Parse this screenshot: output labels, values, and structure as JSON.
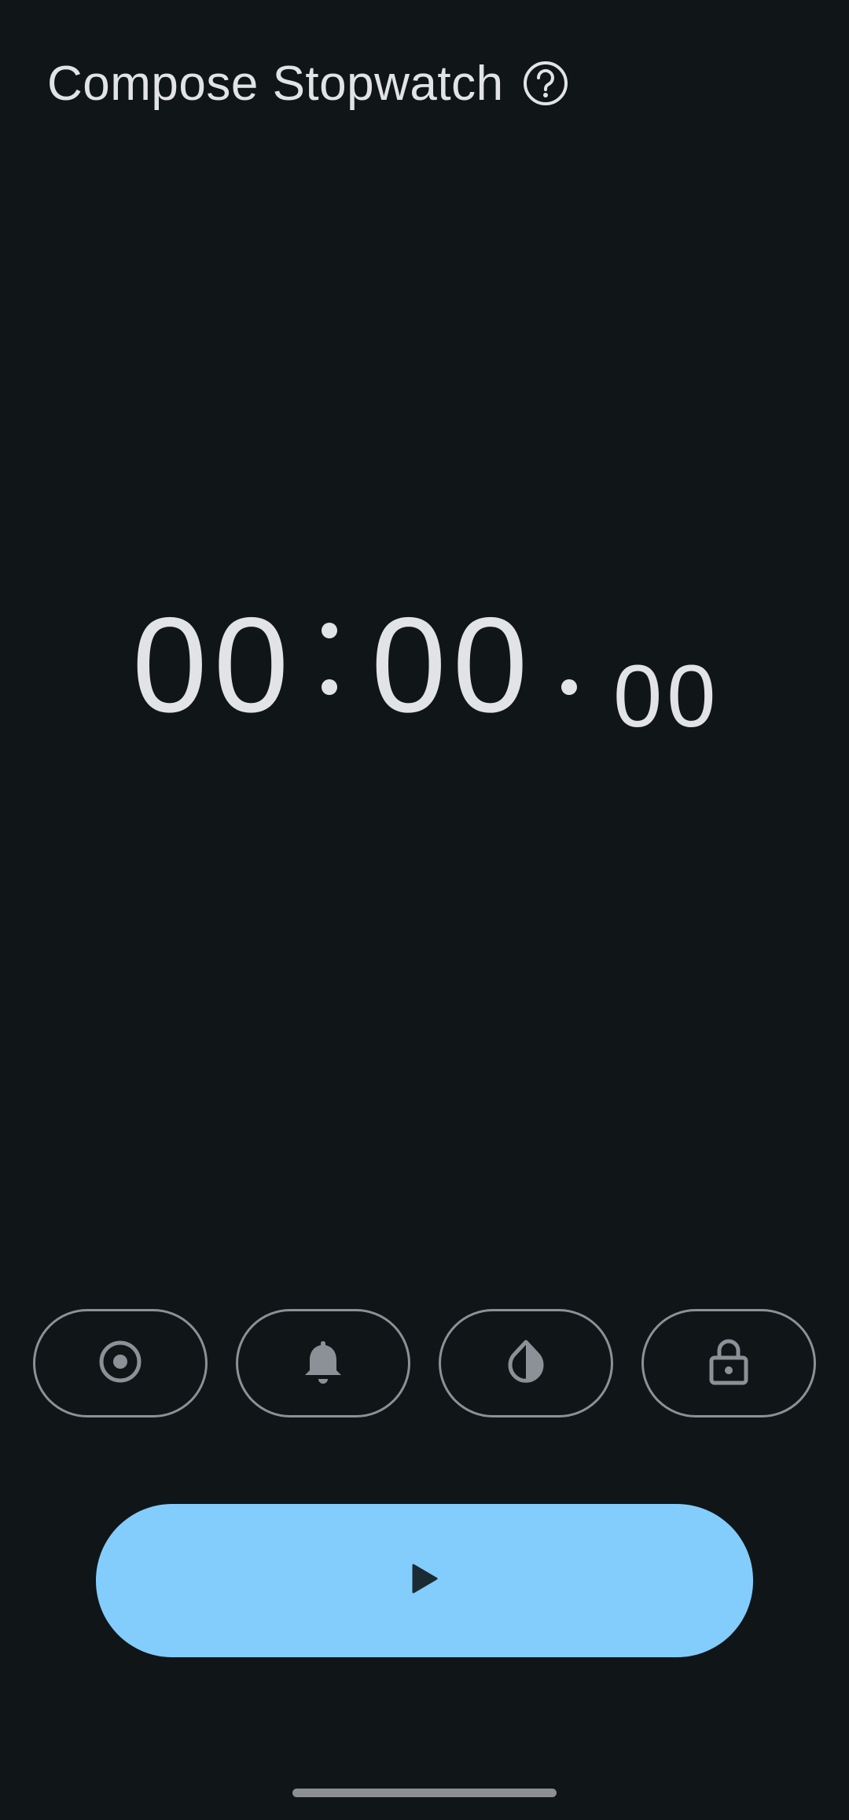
{
  "app": {
    "title": "Compose Stopwatch"
  },
  "icons": {
    "help": "help-circle-icon",
    "record": "radio-button-icon",
    "bell": "bell-icon",
    "theme": "contrast-drop-icon",
    "lock": "lock-icon",
    "play": "play-icon"
  },
  "timer": {
    "minutes": "00",
    "seconds": "00",
    "hundredths": "00"
  },
  "colors": {
    "background": "#101518",
    "text": "#e1e3e6",
    "outline": "#8b9196",
    "icon": "#8b9196",
    "accent": "#82cdfc",
    "on_accent": "#1b2a33"
  }
}
